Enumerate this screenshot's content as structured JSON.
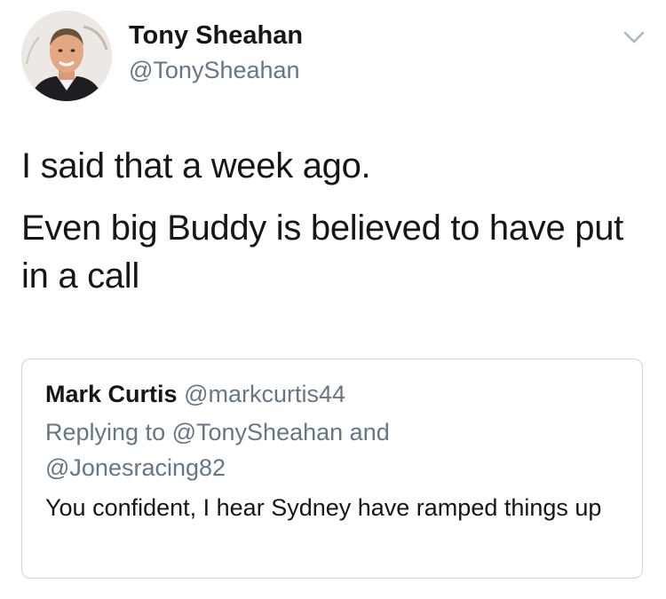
{
  "tweet": {
    "author_name": "Tony Sheahan",
    "author_handle": "@TonySheahan",
    "avatar_icon": "profile-photo",
    "more_icon": "chevron-down-icon",
    "paragraphs": [
      "I said that a week ago.",
      "Even big Buddy is believed to have put in a call"
    ]
  },
  "quoted_tweet": {
    "author_name": "Mark Curtis",
    "author_handle": "@markcurtis44",
    "replying_prefix": "Replying to",
    "reply_to_1": "@TonySheahan",
    "reply_conjunction": "and",
    "reply_to_2": "@Jonesracing82",
    "text": "You confident, I hear Sydney have ramped things up"
  },
  "colors": {
    "text_primary": "#14171a",
    "text_secondary": "#657786",
    "border": "#ccd6dd"
  }
}
